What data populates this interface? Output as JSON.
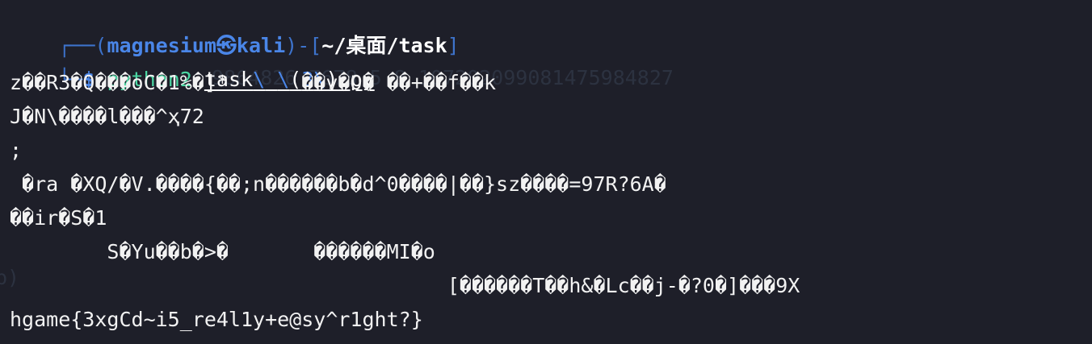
{
  "prompt": {
    "corner_top": "┌──(",
    "user": "magnesium",
    "at_symbol": "㉿",
    "host": "kali",
    "sep": ")-[",
    "path": "~/桌面/task",
    "close": "]",
    "corner_bottom": "└─",
    "dollar": "$",
    "command": "python2",
    "argument_parts": [
      "task",
      "\\",
      " ",
      "\\",
      "(",
      "3",
      "\\",
      ")",
      ".py"
    ]
  },
  "output": {
    "lines": [
      "z��R3�Q���oC�1%�]*      ��v�O� ��+��f��k",
      "J�N\\����l���^ҳ72",
      ";",
      " �ra �XQ/�V.����{��;n������b�d^0����|��}sz����=97R?6A�",
      "��ir�S�1",
      "        S�Yu��b�>�       ������MI�o",
      "                                    [������T��h&�Lc��j-�?0�]���9X",
      "hgame{3xgCd~i5_re4l1y+e@sy^r1ght?}"
    ]
  },
  "background_ghost": {
    "digits": "9864826 7678 5 8 107202099081475984827",
    "paren_left": "p)"
  },
  "colors": {
    "background": "#1e1f29",
    "prompt_blue": "#4a86e8",
    "command_green": "#4bd6a2"
  }
}
